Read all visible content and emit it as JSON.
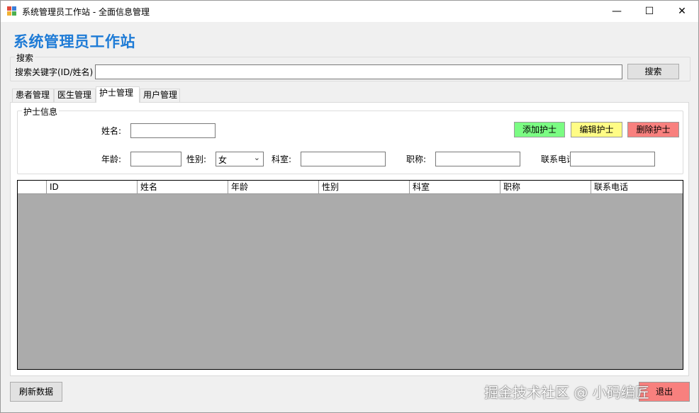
{
  "window": {
    "title": "系统管理员工作站 - 全面信息管理",
    "minimize_glyph": "—",
    "maximize_glyph": "☐",
    "close_glyph": "✕"
  },
  "heading": "系统管理员工作站",
  "search": {
    "group_label": "搜索",
    "field_label": "搜索关键字(ID/姓名)",
    "value": "",
    "button_label": "搜索"
  },
  "tabs": [
    {
      "label": "患者管理"
    },
    {
      "label": "医生管理"
    },
    {
      "label": "护士管理"
    },
    {
      "label": "用户管理"
    }
  ],
  "nurse_form": {
    "group_label": "护士信息",
    "name_label": "姓名:",
    "name_value": "",
    "age_label": "年龄:",
    "age_value": "",
    "gender_label": "性别:",
    "gender_value": "女",
    "department_label": "科室:",
    "department_value": "",
    "title_label": "职称:",
    "title_value": "",
    "phone_label": "联系电话",
    "phone_value": "",
    "add_button": "添加护士",
    "edit_button": "编辑护士",
    "delete_button": "删除护士"
  },
  "grid": {
    "columns": [
      "ID",
      "姓名",
      "年龄",
      "性别",
      "科室",
      "职称",
      "联系电话"
    ]
  },
  "footer": {
    "refresh_button": "刷新数据",
    "exit_button": "退出"
  },
  "watermark": "掘金技术社区 @ 小码编匠",
  "colors": {
    "heading": "#1e7bd6",
    "add": "#7bfc83",
    "edit": "#fffc86",
    "delete": "#f8807e",
    "grid_background": "#ababab"
  }
}
